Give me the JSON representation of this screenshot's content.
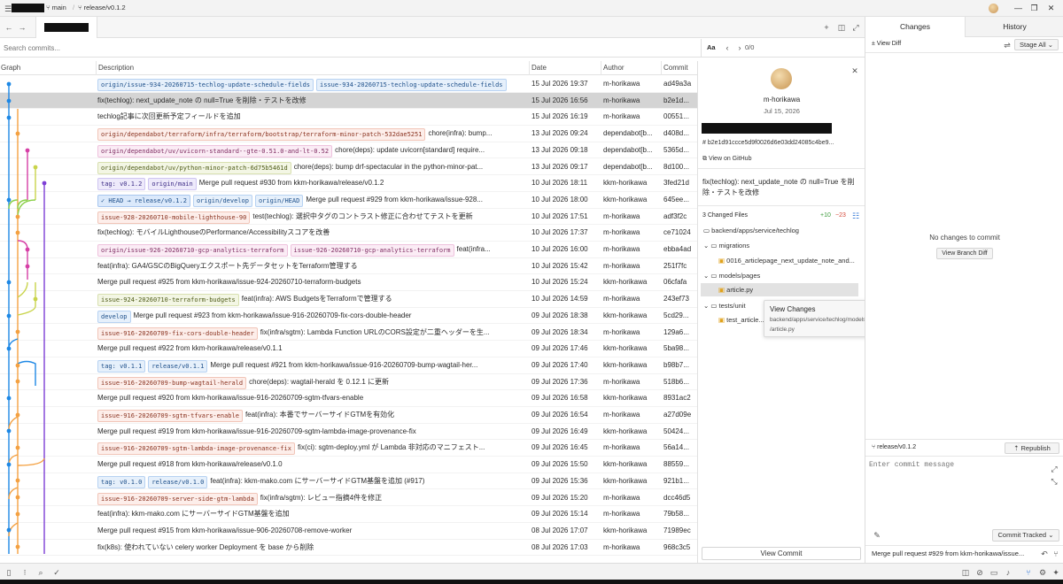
{
  "titlebar": {
    "branch_main": "main",
    "release_branch": "release/v0.1.2"
  },
  "search": {
    "placeholder": "Search commits...",
    "match_case": "Aa",
    "count": "0/0"
  },
  "columns": {
    "graph": "Graph",
    "description": "Description",
    "date": "Date",
    "author": "Author",
    "commit": "Commit"
  },
  "commits": [
    {
      "refs": [
        {
          "text": "origin/issue-934-20260715-techlog-update-schedule-fields",
          "c": "t-blue"
        },
        {
          "text": "issue-934-20260715-techlog-update-schedule-fields",
          "c": "t-blue"
        }
      ],
      "msg": "",
      "date": "15 Jul 2026 19:37",
      "author": "m-horikawa",
      "hash": "ad49a3a"
    },
    {
      "refs": [],
      "msg": "fix(techlog): next_update_note の null=True を削除・テストを改修",
      "date": "15 Jul 2026 16:56",
      "author": "m-horikawa",
      "hash": "b2e1d...",
      "sel": true
    },
    {
      "refs": [],
      "msg": "techlog記事に次回更新予定フィールドを追加",
      "date": "15 Jul 2026 16:19",
      "author": "m-horikawa",
      "hash": "00551..."
    },
    {
      "refs": [
        {
          "text": "origin/dependabot/terraform/infra/terraform/bootstrap/terraform-minor-patch-532dae5251",
          "c": "t-red"
        }
      ],
      "msg": "chore(infra): bump...",
      "date": "13 Jul 2026 09:24",
      "author": "dependabot[b...",
      "hash": "d408d..."
    },
    {
      "refs": [
        {
          "text": "origin/dependabot/uv/uvicorn-standard--gte-0.51.0-and-lt-0.52",
          "c": "t-pink"
        }
      ],
      "msg": "chore(deps): update uvicorn[standard] require...",
      "date": "13 Jul 2026 09:18",
      "author": "dependabot[b...",
      "hash": "5365d..."
    },
    {
      "refs": [
        {
          "text": "origin/dependabot/uv/python-minor-patch-6d75b5461d",
          "c": "t-olive"
        }
      ],
      "msg": "chore(deps): bump drf-spectacular in the python-minor-pat...",
      "date": "13 Jul 2026 09:17",
      "author": "dependabot[b...",
      "hash": "8d100..."
    },
    {
      "refs": [
        {
          "text": "tag: v0.1.2",
          "c": "t-purple"
        },
        {
          "text": "origin/main",
          "c": "t-purple"
        }
      ],
      "msg": "Merge pull request #930 from kkm-horikawa/release/v0.1.2",
      "date": "10 Jul 2026 18:11",
      "author": "kkm-horikawa",
      "hash": "3fed21d"
    },
    {
      "refs": [
        {
          "text": "✓ HEAD → release/v0.1.2",
          "c": "t-head"
        },
        {
          "text": "origin/develop",
          "c": "t-blue"
        },
        {
          "text": "origin/HEAD",
          "c": "t-blue"
        }
      ],
      "msg": "Merge pull request #929 from kkm-horikawa/issue-928...",
      "date": "10 Jul 2026 18:00",
      "author": "kkm-horikawa",
      "hash": "645ee..."
    },
    {
      "refs": [
        {
          "text": "issue-928-20260710-mobile-lighthouse-90",
          "c": "t-red"
        }
      ],
      "msg": "test(techlog): 選択中タグのコントラスト修正に合わせてテストを更新",
      "date": "10 Jul 2026 17:51",
      "author": "m-horikawa",
      "hash": "adf3f2c"
    },
    {
      "refs": [],
      "msg": "fix(techlog): モバイルLighthouseのPerformance/Accessibilityスコアを改善",
      "date": "10 Jul 2026 17:37",
      "author": "m-horikawa",
      "hash": "ce71024"
    },
    {
      "refs": [
        {
          "text": "origin/issue-926-20260710-gcp-analytics-terraform",
          "c": "t-pink"
        },
        {
          "text": "issue-926-20260710-gcp-analytics-terraform",
          "c": "t-pink"
        }
      ],
      "msg": "feat(infra...",
      "date": "10 Jul 2026 16:00",
      "author": "m-horikawa",
      "hash": "ebba4ad"
    },
    {
      "refs": [],
      "msg": "feat(infra): GA4/GSCのBigQueryエクスポート先データセットをTerraform管理する",
      "date": "10 Jul 2026 15:42",
      "author": "m-horikawa",
      "hash": "251f7fc"
    },
    {
      "refs": [],
      "msg": "Merge pull request #925 from kkm-horikawa/issue-924-20260710-terraform-budgets",
      "date": "10 Jul 2026 15:24",
      "author": "kkm-horikawa",
      "hash": "06cfafa"
    },
    {
      "refs": [
        {
          "text": "issue-924-20260710-terraform-budgets",
          "c": "t-olive"
        }
      ],
      "msg": "feat(infra): AWS BudgetsをTerraformで管理する",
      "date": "10 Jul 2026 14:59",
      "author": "m-horikawa",
      "hash": "243ef73"
    },
    {
      "refs": [
        {
          "text": "develop",
          "c": "t-blue"
        }
      ],
      "msg": "Merge pull request #923 from kkm-horikawa/issue-916-20260709-fix-cors-double-header",
      "date": "09 Jul 2026 18:38",
      "author": "kkm-horikawa",
      "hash": "5cd29..."
    },
    {
      "refs": [
        {
          "text": "issue-916-20260709-fix-cors-double-header",
          "c": "t-red"
        }
      ],
      "msg": "fix(infra/sgtm): Lambda Function URLのCORS設定が二重ヘッダーを生...",
      "date": "09 Jul 2026 18:34",
      "author": "m-horikawa",
      "hash": "129a6..."
    },
    {
      "refs": [],
      "msg": "Merge pull request #922 from kkm-horikawa/release/v0.1.1",
      "date": "09 Jul 2026 17:46",
      "author": "kkm-horikawa",
      "hash": "5ba98..."
    },
    {
      "refs": [
        {
          "text": "tag: v0.1.1",
          "c": "t-blue"
        },
        {
          "text": "release/v0.1.1",
          "c": "t-blue"
        }
      ],
      "msg": "Merge pull request #921 from kkm-horikawa/issue-916-20260709-bump-wagtail-her...",
      "date": "09 Jul 2026 17:40",
      "author": "kkm-horikawa",
      "hash": "b98b7..."
    },
    {
      "refs": [
        {
          "text": "issue-916-20260709-bump-wagtail-herald",
          "c": "t-red"
        }
      ],
      "msg": "chore(deps): wagtail-herald を 0.12.1 に更新",
      "date": "09 Jul 2026 17:36",
      "author": "m-horikawa",
      "hash": "518b6..."
    },
    {
      "refs": [],
      "msg": "Merge pull request #920 from kkm-horikawa/issue-916-20260709-sgtm-tfvars-enable",
      "date": "09 Jul 2026 16:58",
      "author": "kkm-horikawa",
      "hash": "8931ac2"
    },
    {
      "refs": [
        {
          "text": "issue-916-20260709-sgtm-tfvars-enable",
          "c": "t-red"
        }
      ],
      "msg": "feat(infra): 本番でサーバーサイドGTMを有効化",
      "date": "09 Jul 2026 16:54",
      "author": "m-horikawa",
      "hash": "a27d09e"
    },
    {
      "refs": [],
      "msg": "Merge pull request #919 from kkm-horikawa/issue-916-20260709-sgtm-lambda-image-provenance-fix",
      "date": "09 Jul 2026 16:49",
      "author": "kkm-horikawa",
      "hash": "50424..."
    },
    {
      "refs": [
        {
          "text": "issue-916-20260709-sgtm-lambda-image-provenance-fix",
          "c": "t-red"
        }
      ],
      "msg": "fix(ci): sgtm-deploy.yml が Lambda 非対応のマニフェスト...",
      "date": "09 Jul 2026 16:45",
      "author": "m-horikawa",
      "hash": "56a14..."
    },
    {
      "refs": [],
      "msg": "Merge pull request #918 from kkm-horikawa/release/v0.1.0",
      "date": "09 Jul 2026 15:50",
      "author": "kkm-horikawa",
      "hash": "88559..."
    },
    {
      "refs": [
        {
          "text": "tag: v0.1.0",
          "c": "t-blue"
        },
        {
          "text": "release/v0.1.0",
          "c": "t-blue"
        }
      ],
      "msg": "feat(infra): kkm-mako.com にサーバーサイドGTM基盤を追加 (#917)",
      "date": "09 Jul 2026 15:36",
      "author": "kkm-horikawa",
      "hash": "921b1..."
    },
    {
      "refs": [
        {
          "text": "issue-916-20260709-server-side-gtm-lambda",
          "c": "t-red"
        }
      ],
      "msg": "fix(infra/sgtm): レビュー指摘4件を修正",
      "date": "09 Jul 2026 15:20",
      "author": "m-horikawa",
      "hash": "dcc46d5"
    },
    {
      "refs": [],
      "msg": "feat(infra): kkm-mako.com にサーバーサイドGTM基盤を追加",
      "date": "09 Jul 2026 15:14",
      "author": "m-horikawa",
      "hash": "79b58..."
    },
    {
      "refs": [],
      "msg": "Merge pull request #915 from kkm-horikawa/issue-906-20260708-remove-worker",
      "date": "08 Jul 2026 17:07",
      "author": "kkm-horikawa",
      "hash": "71989ec"
    },
    {
      "refs": [],
      "msg": "fix(k8s): 使われていない celery worker Deployment を base から削除",
      "date": "08 Jul 2026 17:03",
      "author": "m-horikawa",
      "hash": "968c3c5"
    }
  ],
  "details": {
    "author": "m-horikawa",
    "date": "Jul 15, 2026",
    "hash": "b2e1d91ccce5d9f0026d6e03dd24085c4be9...",
    "view_on_github": "View on GitHub",
    "message": "fix(techlog): next_update_note の null=True を削除・テストを改修",
    "changed_files": "3 Changed Files",
    "additions": "+10",
    "deletions": "−23",
    "tree": {
      "root": "backend/apps/service/techlog",
      "migrations": "migrations",
      "migration_file": "0016_articlepage_next_update_note_and...",
      "models": "models/pages",
      "models_file": "article.py",
      "tests": "tests/unit",
      "tests_file": "test_article..."
    },
    "view_commit": "View Commit"
  },
  "tooltip": {
    "title": "View Changes",
    "path1": "backend/apps/service/techlog/models/pages",
    "path2": "/article.py"
  },
  "right": {
    "tab_changes": "Changes",
    "tab_history": "History",
    "view_diff": "View Diff",
    "stage_all": "Stage All",
    "no_changes": "No changes to commit",
    "view_branch_diff": "View Branch Diff",
    "branch": "release/v0.1.2",
    "republish": "Republish",
    "commit_placeholder": "Enter commit message",
    "commit_tracked": "Commit Tracked",
    "last_commit": "Merge pull request #929 from kkm-horikawa/issue..."
  }
}
